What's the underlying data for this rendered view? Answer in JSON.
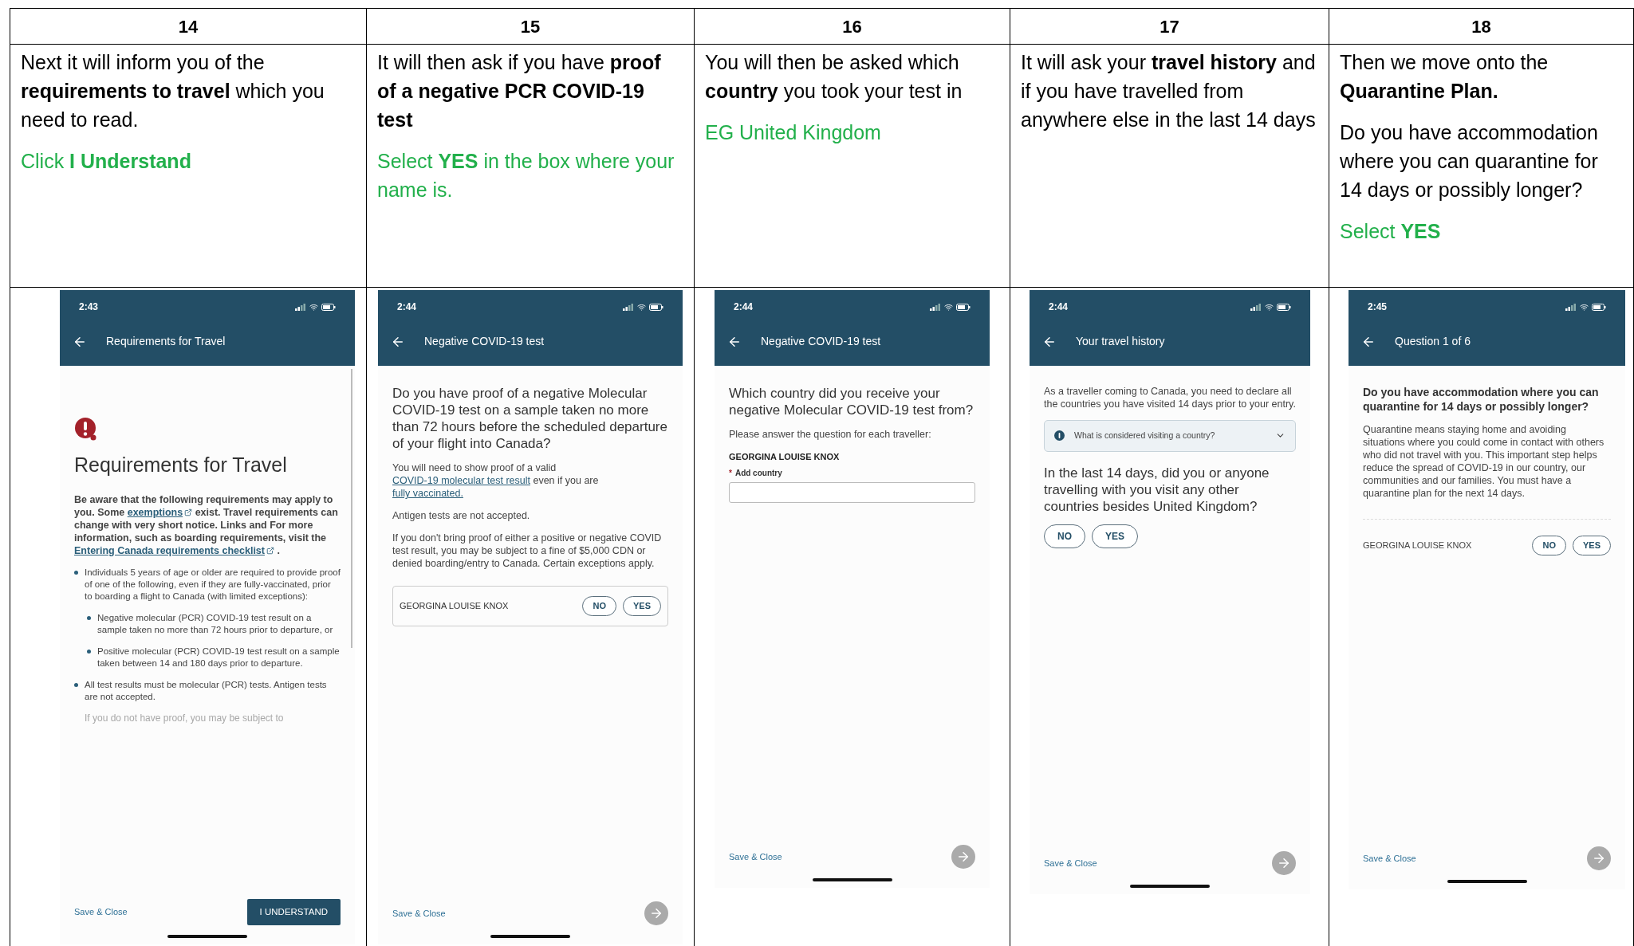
{
  "columns": [
    {
      "number": "14",
      "notes": [
        {
          "kind": "instruction",
          "text": "Next it will inform you of the **requirements to travel** which you need to read."
        },
        {
          "kind": "action",
          "text": "Click **I Understand**"
        }
      ],
      "phone": {
        "time": "2:43",
        "title": "Requirements for Travel",
        "scrollbar": true,
        "blocks": [
          {
            "kind": "alert"
          },
          {
            "kind": "title",
            "text": "Requirements for Travel"
          },
          {
            "kind": "text",
            "bold": true,
            "segments": [
              {
                "text": "Be aware that the following requirements may apply to you. Some "
              },
              {
                "text": "exemptions",
                "link": true,
                "external": true
              },
              {
                "text": " exist. Travel requirements can change with very short notice. Links and For more information, such as boarding requirements, visit the "
              },
              {
                "text": "Entering Canada requirements checklist",
                "link": true,
                "external": true
              },
              {
                "text": " ."
              }
            ]
          },
          {
            "kind": "bullet",
            "text": "Individuals 5 years of age or older are required to provide proof of one of the following, even if they are fully-vaccinated, prior to boarding a flight to Canada (with limited exceptions):",
            "children": [
              {
                "text": "Negative molecular (PCR) COVID-19 test result on a sample taken no more than 72 hours prior to departure, or"
              },
              {
                "text": "Positive molecular (PCR) COVID-19 test result on a sample taken between 14 and 180 days prior to departure."
              }
            ]
          },
          {
            "kind": "bullet",
            "text": "All test results must be molecular (PCR) tests. Antigen tests are not accepted."
          },
          {
            "kind": "faded",
            "text": "If you do not have proof, you may be subject to"
          }
        ],
        "footer": {
          "link": "Save & Close",
          "button": "I UNDERSTAND"
        }
      }
    },
    {
      "number": "15",
      "notes": [
        {
          "kind": "instruction",
          "text": "It will then ask if you have **proof of a negative PCR COVID-19 test**"
        },
        {
          "kind": "action",
          "text": "Select **YES** in the box where your name is."
        }
      ],
      "phone": {
        "time": "2:44",
        "title": "Negative COVID-19 test",
        "scrollbar": false,
        "blocks": [
          {
            "kind": "question",
            "text": "Do you have proof of a negative Molecular COVID-19 test on a sample taken no more than 72 hours before the scheduled departure of your flight into Canada?"
          },
          {
            "kind": "text",
            "bold": false,
            "segments": [
              {
                "text": "You will need to show proof of a valid "
              },
              {
                "text": "COVID-19 molecular test result",
                "link": true,
                "external": false
              },
              {
                "text": " even if you are "
              },
              {
                "text": "fully vaccinated.",
                "link": true,
                "external": false
              }
            ]
          },
          {
            "kind": "text",
            "bold": false,
            "segments": [
              {
                "text": "Antigen tests are not accepted."
              }
            ]
          },
          {
            "kind": "text",
            "bold": false,
            "segments": [
              {
                "text": "If you don't bring proof of either a positive or negative COVID test result, you may be subject to a fine of $5,000 CDN or denied boarding/entry to Canada. Certain exceptions apply."
              }
            ]
          },
          {
            "kind": "choice_card",
            "name": "GEORGINA LOUISE KNOX",
            "options": [
              {
                "label": "NO",
                "selected": false
              },
              {
                "label": "YES",
                "selected": false
              }
            ]
          }
        ],
        "footer": {
          "link": "Save & Close",
          "next_disabled": true
        }
      }
    },
    {
      "number": "16",
      "notes": [
        {
          "kind": "instruction",
          "text": "You will then be asked which **country** you took your test in"
        },
        {
          "kind": "action",
          "text": "EG United Kingdom"
        }
      ],
      "phone": {
        "time": "2:44",
        "title": "Negative COVID-19 test",
        "scrollbar": false,
        "blocks": [
          {
            "kind": "question",
            "text": "Which country did you receive your negative Molecular COVID-19 test from?"
          },
          {
            "kind": "text",
            "bold": false,
            "segments": [
              {
                "text": "Please answer the question for each traveller:"
              }
            ]
          },
          {
            "kind": "label",
            "text": "GEORGINA LOUISE KNOX"
          },
          {
            "kind": "field",
            "required_mark": "*",
            "label": "Add country"
          }
        ],
        "footer": {
          "link": "Save & Close",
          "next_disabled": true
        }
      }
    },
    {
      "number": "17",
      "notes": [
        {
          "kind": "instruction",
          "text": "It will ask your **travel history** and if you have travelled from anywhere else in the last 14 days"
        }
      ],
      "phone": {
        "time": "2:44",
        "title": "Your travel history",
        "scrollbar": false,
        "blocks": [
          {
            "kind": "text",
            "bold": false,
            "segments": [
              {
                "text": "As a traveller coming to Canada, you need to declare all the countries you have visited 14 days prior to your entry."
              }
            ]
          },
          {
            "kind": "info",
            "text": "What is considered visiting a country?",
            "expanded": false
          },
          {
            "kind": "question",
            "text": "In the last 14 days, did you or anyone travelling with you visit any other countries besides United Kingdom?"
          },
          {
            "kind": "choices",
            "options": [
              {
                "label": "NO",
                "selected": false
              },
              {
                "label": "YES",
                "selected": false
              }
            ]
          }
        ],
        "footer": {
          "link": "Save & Close",
          "next_disabled": true
        }
      }
    },
    {
      "number": "18",
      "notes": [
        {
          "kind": "instruction",
          "text": "Then we move onto the **Quarantine Plan.**"
        },
        {
          "kind": "instruction",
          "text": "Do you have accommodation where you can quarantine for 14 days or possibly longer?"
        },
        {
          "kind": "action",
          "text": "Select **YES**"
        }
      ],
      "phone": {
        "time": "2:45",
        "title": "Question 1 of 6",
        "scrollbar": false,
        "blocks": [
          {
            "kind": "bold_question",
            "text": "Do you have accommodation where you can quarantine for 14 days or possibly longer?"
          },
          {
            "kind": "text",
            "bold": false,
            "segments": [
              {
                "text": "Quarantine means staying home and avoiding situations where you could come in contact with others who did not travel with you. This important step helps reduce the spread of COVID-19 in our country, our communities and our families. You must have a quarantine plan for the next 14 days."
              }
            ]
          },
          {
            "kind": "divider"
          },
          {
            "kind": "choice_row",
            "name": "GEORGINA LOUISE KNOX",
            "options": [
              {
                "label": "NO",
                "selected": false
              },
              {
                "label": "YES",
                "selected": false
              }
            ]
          }
        ],
        "footer": {
          "link": "Save & Close",
          "next_disabled": true
        }
      }
    }
  ]
}
